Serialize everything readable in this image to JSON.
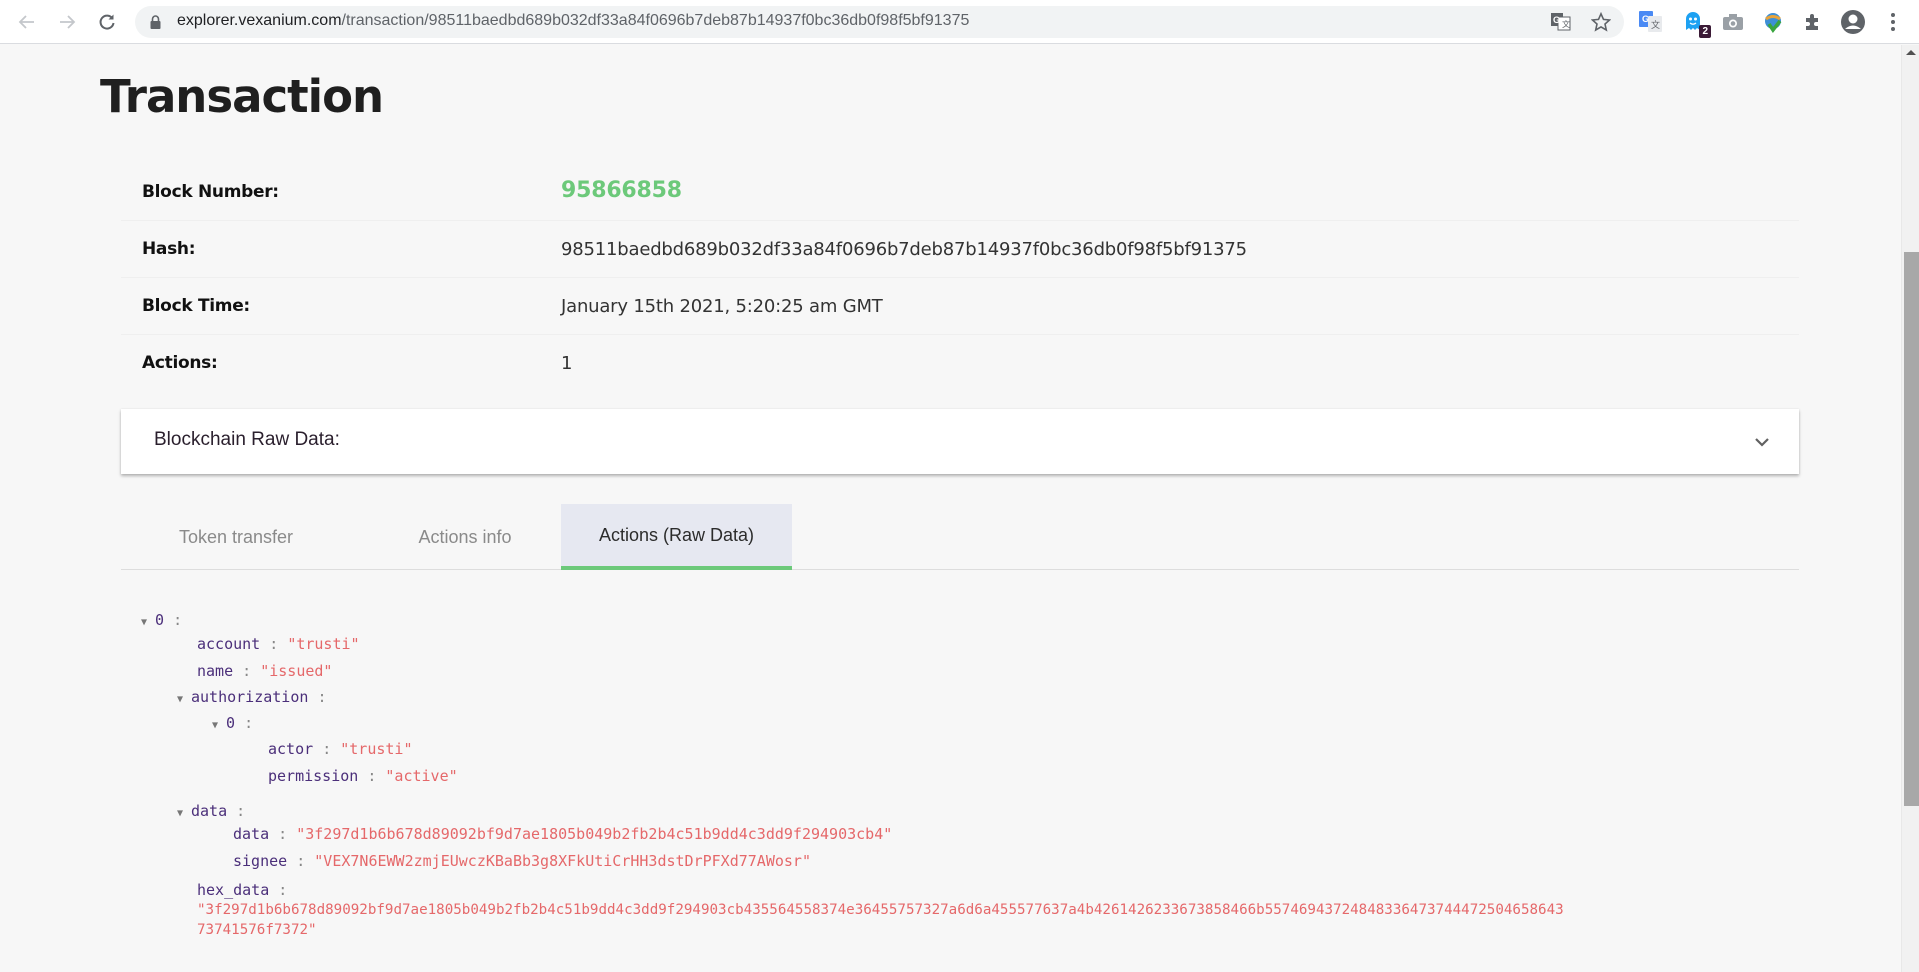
{
  "browser": {
    "url_host": "explorer.vexanium.com",
    "url_path": "/transaction/98511baedbd689b032df33a84f0696b7deb87b14937f0bc36db0f98f5bf91375",
    "extensions": [
      {
        "name": "google-translate"
      },
      {
        "name": "ghostery",
        "badge": "2"
      },
      {
        "name": "screenshot-camera"
      },
      {
        "name": "internet-download-manager"
      },
      {
        "name": "extensions-puzzle"
      }
    ]
  },
  "page": {
    "title": "Transaction",
    "details": [
      {
        "label": "Block Number:",
        "value": "95866858"
      },
      {
        "label": "Hash:",
        "value": "98511baedbd689b032df33a84f0696b7deb87b14937f0bc36db0f98f5bf91375"
      },
      {
        "label": "Block Time:",
        "value": "January 15th 2021, 5:20:25 am GMT"
      },
      {
        "label": "Actions:",
        "value": "1"
      }
    ],
    "raw_panel": {
      "title": "Blockchain Raw Data:"
    },
    "tabs": [
      {
        "label": "Token transfer",
        "active": false
      },
      {
        "label": "Actions info",
        "active": false
      },
      {
        "label": "Actions (Raw Data)",
        "active": true
      }
    ]
  },
  "actions_raw": {
    "index": "0",
    "account_key": "account",
    "account": "\"trusti\"",
    "name_key": "name",
    "name": "\"issued\"",
    "authorization_key": "authorization",
    "auth_index": "0",
    "actor_key": "actor",
    "actor": "\"trusti\"",
    "permission_key": "permission",
    "permission": "\"active\"",
    "data_key": "data",
    "data_data_key": "data",
    "data_data": "\"3f297d1b6b678d89092bf9d7ae1805b049b2fb2b4c51b9dd4c3dd9f294903cb4\"",
    "signee_key": "signee",
    "signee": "\"VEX7N6EWW2zmjEUwczKBaBb3g8XFkUtiCrHH3dstDrPFXd77AWosr\"",
    "hex_data_key": "hex_data",
    "hex_data_line1": "\"3f297d1b6b678d89092bf9d7ae1805b049b2fb2b4c51b9dd4c3dd9f294903cb435564558374e36455757327a6d6a455577637a4b4261426233673858466b55746943724848336473744472504658643",
    "hex_data_line2": "73741576f7372\"",
    "colon": ":"
  },
  "colors": {
    "accent_green": "#6cc97a",
    "json_key": "#4b2f7a",
    "json_string": "#e5686a",
    "active_tab_bg": "#e6e8f1"
  }
}
